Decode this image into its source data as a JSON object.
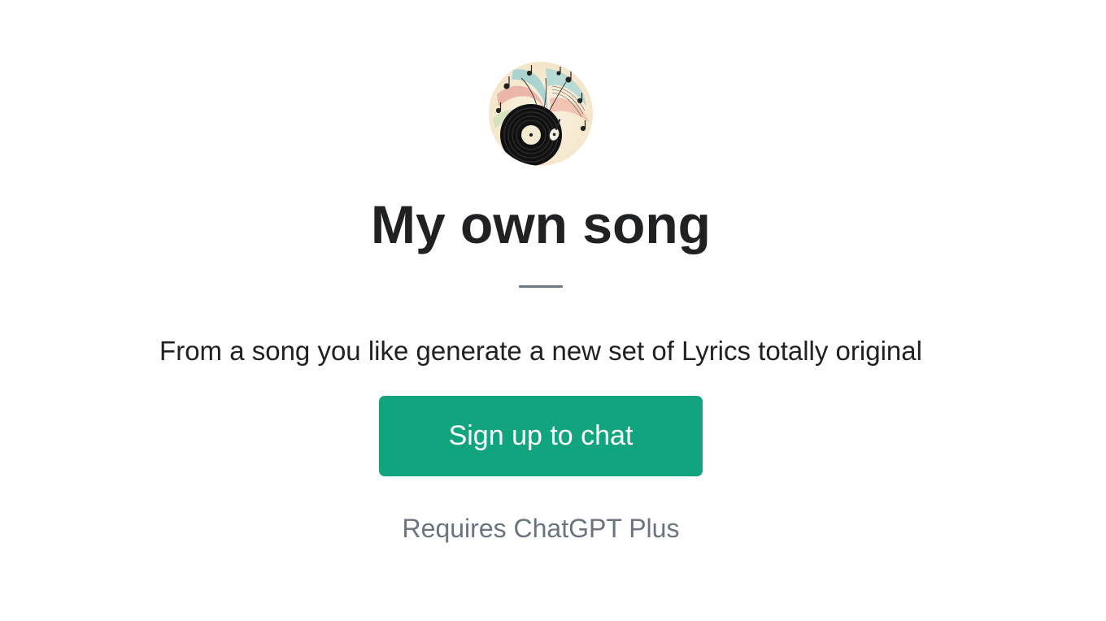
{
  "gpt": {
    "avatar_icon": "vinyl-record-music-notes-icon",
    "title": "My own song",
    "description": "From a song you like generate a new set of Lyrics totally original",
    "signup_label": "Sign up to chat",
    "requirement": "Requires ChatGPT Plus"
  },
  "colors": {
    "button": "#12a37f",
    "button_text": "#ffffff",
    "title": "#202123",
    "muted": "#6b7280",
    "divider": "#6e7681"
  }
}
